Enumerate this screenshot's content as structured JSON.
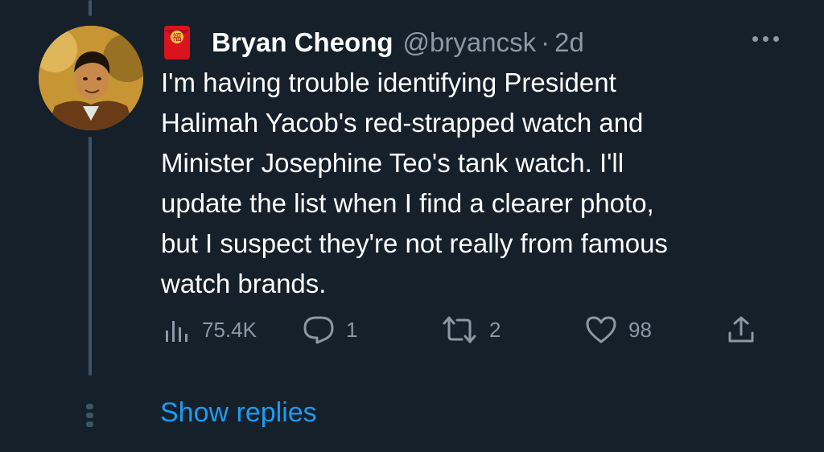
{
  "tweet": {
    "author_name": "Bryan Cheong",
    "handle": "@bryancsk",
    "separator": "·",
    "time": "2d",
    "badge_icon": "red-envelope-icon",
    "badge_glyph": "福",
    "text_lines": [
      "I'm having trouble identifying President",
      "Halimah Yacob's red-strapped watch and",
      "Minister Josephine Teo's tank watch. I'll",
      "update the list when I find a clearer photo,",
      "but I suspect they're not really from famous",
      "watch brands."
    ],
    "views": "75.4K",
    "replies": "1",
    "retweets": "2",
    "likes": "98"
  },
  "show_replies_label": "Show replies",
  "colors": {
    "background": "#15202b",
    "text": "#ffffff",
    "muted": "#8b98a5",
    "accent": "#1d9bf0",
    "thread_line": "#3d5466",
    "envelope": "#d9141f"
  }
}
